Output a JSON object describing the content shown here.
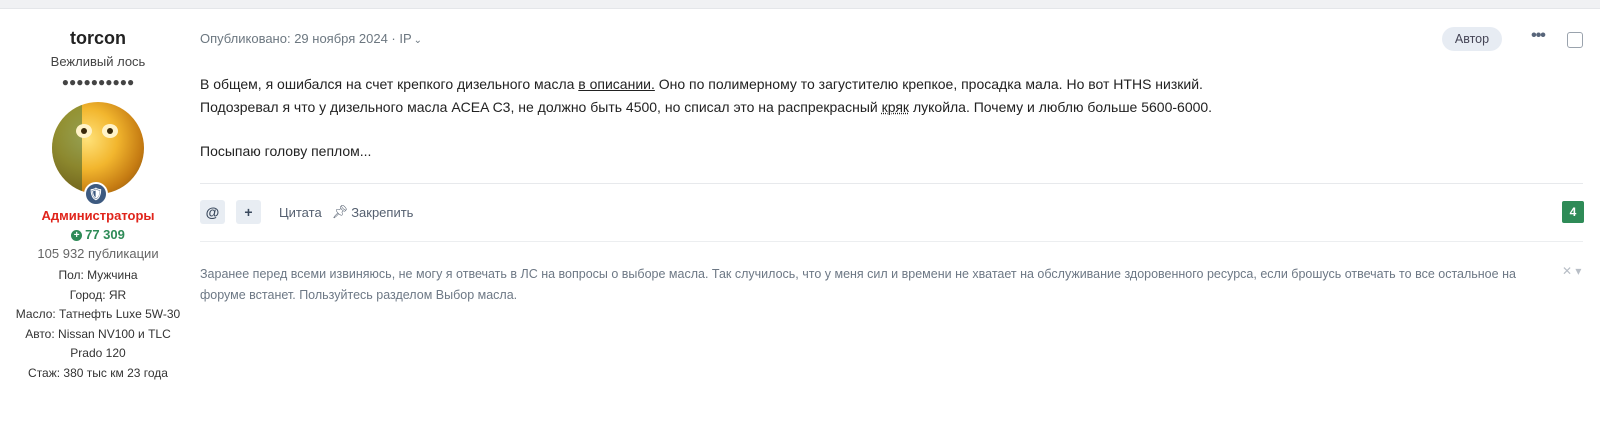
{
  "author": {
    "username": "torcon",
    "rank_title": "Вежливый лось",
    "rank_pips": "●●●●●●●●●●",
    "group": "Администраторы",
    "reputation": "77 309",
    "post_count": "105 932 публикации",
    "fields": [
      "Пол: Мужчина",
      "Город: ЯR",
      "Масло: Татнефть Luxe 5W-30",
      "Авто: Nissan NV100 и TLC Prado 120",
      "Стаж: 380 тыс км 23 года"
    ]
  },
  "post": {
    "meta": "Опубликовано: 29 ноября 2024 · IP",
    "author_badge": "Автор",
    "content": {
      "line1_before": "В общем, я ошибался на счет крепкого дизельного масла ",
      "line1_link": "в описании.",
      "line1_after": " Оно по полимерному то загустителю крепкое, просадка мала. Но вот HTHS низкий.",
      "line2_before": "Подозревал я что у дизельного масла ACEA C3, не должно быть 4500, но списал это на распрекрасный ",
      "line2_dotted": "кряк",
      "line2_after": " лукойла. Почему и люблю больше 5600-6000.",
      "line3": "Посыпаю голову пеплом..."
    },
    "actions": {
      "mention_icon": "@",
      "add_icon": "+",
      "quote_label": "Цитата",
      "pin_label": "Закрепить"
    },
    "reaction_count": "4",
    "signature": "Заранее перед всеми извиняюсь, не могу я отвечать в ЛС на вопросы о выборе масла. Так случилось, что у меня сил и времени не хватает на обслуживание здоровенного ресурса, если брошусь отвечать то все остальное на форуме встанет. Пользуйтесь разделом Выбор масла."
  },
  "colors": {
    "group": "#e0241b",
    "reputation": "#2e8b57",
    "count_badge": "#2e8b57"
  }
}
